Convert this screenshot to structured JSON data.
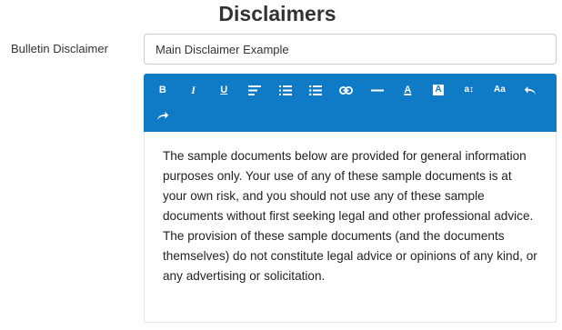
{
  "page_title": "Disclaimers",
  "form": {
    "label": "Bulletin Disclaimer",
    "title_value": "Main Disclaimer Example"
  },
  "toolbar": {
    "color": "#0f7ac6",
    "buttons": [
      {
        "name": "bold-button",
        "icon": "bold-icon",
        "glyph": "B"
      },
      {
        "name": "italic-button",
        "icon": "italic-icon",
        "glyph": "I"
      },
      {
        "name": "underline-button",
        "icon": "underline-icon",
        "glyph": "U"
      },
      {
        "name": "align-button",
        "icon": "align-left-icon",
        "glyph": ""
      },
      {
        "name": "ordered-list-button",
        "icon": "ordered-list-icon",
        "glyph": ""
      },
      {
        "name": "unordered-list-button",
        "icon": "unordered-list-icon",
        "glyph": ""
      },
      {
        "name": "link-button",
        "icon": "link-icon",
        "glyph": ""
      },
      {
        "name": "horizontal-rule-button",
        "icon": "horizontal-rule-icon",
        "glyph": ""
      },
      {
        "name": "text-color-button",
        "icon": "text-color-icon",
        "glyph": "A"
      },
      {
        "name": "background-color-button",
        "icon": "background-color-icon",
        "glyph": "A"
      },
      {
        "name": "font-size-button",
        "icon": "font-size-icon",
        "glyph": "a↕"
      },
      {
        "name": "font-family-button",
        "icon": "font-family-icon",
        "glyph": "Aa"
      },
      {
        "name": "undo-button",
        "icon": "undo-icon",
        "glyph": ""
      },
      {
        "name": "redo-button",
        "icon": "redo-icon",
        "glyph": ""
      }
    ]
  },
  "editor": {
    "body_text": "The sample documents below are provided for general information purposes only. Your use of any of these sample documents is at your own risk, and you should not use any of these sample documents without first seeking legal and other professional advice. The provision of these sample documents (and the documents themselves) do not constitute legal advice or opinions of any kind, or any advertising or solicitation."
  }
}
